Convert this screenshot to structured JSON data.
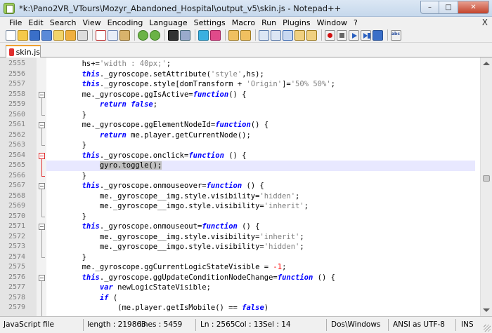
{
  "window": {
    "title": "*k:\\Pano2VR_VTours\\Mozyr_Abandoned_Hospital\\output_v5\\skin.js - Notepad++",
    "minimize": "–",
    "maximize": "□",
    "close": "✕"
  },
  "menu": {
    "items": [
      "File",
      "Edit",
      "Search",
      "View",
      "Encoding",
      "Language",
      "Settings",
      "Macro",
      "Run",
      "Plugins",
      "Window",
      "?"
    ],
    "close_glyph": "X"
  },
  "toolbar": {
    "icons": [
      "new-file-icon",
      "open-file-icon",
      "save-icon",
      "save-all-icon",
      "close-file-icon",
      "close-all-icon",
      "print-icon",
      "cut-icon",
      "copy-icon",
      "paste-icon",
      "undo-icon",
      "redo-icon",
      "find-icon",
      "replace-icon",
      "zoom-in-icon",
      "zoom-out-icon",
      "sync-vertical-icon",
      "sync-horizontal-icon",
      "word-wrap-icon",
      "show-all-chars-icon",
      "indent-guide-icon",
      "user-defined-language-icon",
      "document-map-icon",
      "record-macro-icon",
      "stop-recording-icon",
      "playback-macro-icon",
      "run-macro-multiple-icon",
      "save-macro-icon",
      "spell-check-icon"
    ]
  },
  "tabs": [
    {
      "label": "skin.js",
      "active": true,
      "modified": true
    }
  ],
  "editor": {
    "current_line": 2565,
    "lines": [
      {
        "n": "2555",
        "segs": [
          {
            "t": "        hs+=",
            "c": ""
          },
          {
            "t": "'width : 40px;'",
            "c": "str"
          },
          {
            "t": ";",
            "c": ""
          }
        ]
      },
      {
        "n": "2556",
        "segs": [
          {
            "t": "        ",
            "c": ""
          },
          {
            "t": "this",
            "c": "kw"
          },
          {
            "t": "._gyroscope.setAttribute(",
            "c": ""
          },
          {
            "t": "'style'",
            "c": "str"
          },
          {
            "t": ",hs);",
            "c": ""
          }
        ]
      },
      {
        "n": "2557",
        "segs": [
          {
            "t": "        ",
            "c": ""
          },
          {
            "t": "this",
            "c": "kw"
          },
          {
            "t": "._gyroscope.style[domTransform + ",
            "c": ""
          },
          {
            "t": "'Origin'",
            "c": "str"
          },
          {
            "t": "]=",
            "c": ""
          },
          {
            "t": "'50% 50%'",
            "c": "str"
          },
          {
            "t": ";",
            "c": ""
          }
        ]
      },
      {
        "n": "2558",
        "segs": [
          {
            "t": "        me._gyroscope.ggIsActive=",
            "c": ""
          },
          {
            "t": "function",
            "c": "kw"
          },
          {
            "t": "() {",
            "c": ""
          }
        ]
      },
      {
        "n": "2559",
        "segs": [
          {
            "t": "            ",
            "c": ""
          },
          {
            "t": "return",
            "c": "kw"
          },
          {
            "t": " ",
            "c": ""
          },
          {
            "t": "false",
            "c": "kw"
          },
          {
            "t": ";",
            "c": ""
          }
        ]
      },
      {
        "n": "2560",
        "segs": [
          {
            "t": "        }",
            "c": ""
          }
        ]
      },
      {
        "n": "2561",
        "segs": [
          {
            "t": "        me._gyroscope.ggElementNodeId=",
            "c": ""
          },
          {
            "t": "function",
            "c": "kw"
          },
          {
            "t": "() {",
            "c": ""
          }
        ]
      },
      {
        "n": "2562",
        "segs": [
          {
            "t": "            ",
            "c": ""
          },
          {
            "t": "return",
            "c": "kw"
          },
          {
            "t": " me.player.getCurrentNode();",
            "c": ""
          }
        ]
      },
      {
        "n": "2563",
        "segs": [
          {
            "t": "        }",
            "c": ""
          }
        ]
      },
      {
        "n": "2564",
        "segs": [
          {
            "t": "        ",
            "c": ""
          },
          {
            "t": "this",
            "c": "kw"
          },
          {
            "t": "._gyroscope.onclick=",
            "c": ""
          },
          {
            "t": "function",
            "c": "kw"
          },
          {
            "t": " () {",
            "c": ""
          }
        ]
      },
      {
        "n": "2565",
        "segs": [
          {
            "t": "            ",
            "c": ""
          },
          {
            "t": "gyro.toggle();",
            "c": "sel"
          }
        ]
      },
      {
        "n": "2566",
        "segs": [
          {
            "t": "        }",
            "c": ""
          }
        ]
      },
      {
        "n": "2567",
        "segs": [
          {
            "t": "        ",
            "c": ""
          },
          {
            "t": "this",
            "c": "kw"
          },
          {
            "t": "._gyroscope.onmouseover=",
            "c": ""
          },
          {
            "t": "function",
            "c": "kw"
          },
          {
            "t": " () {",
            "c": ""
          }
        ]
      },
      {
        "n": "2568",
        "segs": [
          {
            "t": "            me._gyroscope__img.style.visibility=",
            "c": ""
          },
          {
            "t": "'hidden'",
            "c": "str"
          },
          {
            "t": ";",
            "c": ""
          }
        ]
      },
      {
        "n": "2569",
        "segs": [
          {
            "t": "            me._gyroscope__imgo.style.visibility=",
            "c": ""
          },
          {
            "t": "'inherit'",
            "c": "str"
          },
          {
            "t": ";",
            "c": ""
          }
        ]
      },
      {
        "n": "2570",
        "segs": [
          {
            "t": "        }",
            "c": ""
          }
        ]
      },
      {
        "n": "2571",
        "segs": [
          {
            "t": "        ",
            "c": ""
          },
          {
            "t": "this",
            "c": "kw"
          },
          {
            "t": "._gyroscope.onmouseout=",
            "c": ""
          },
          {
            "t": "function",
            "c": "kw"
          },
          {
            "t": " () {",
            "c": ""
          }
        ]
      },
      {
        "n": "2572",
        "segs": [
          {
            "t": "            me._gyroscope__img.style.visibility=",
            "c": ""
          },
          {
            "t": "'inherit'",
            "c": "str"
          },
          {
            "t": ";",
            "c": ""
          }
        ]
      },
      {
        "n": "2573",
        "segs": [
          {
            "t": "            me._gyroscope__imgo.style.visibility=",
            "c": ""
          },
          {
            "t": "'hidden'",
            "c": "str"
          },
          {
            "t": ";",
            "c": ""
          }
        ]
      },
      {
        "n": "2574",
        "segs": [
          {
            "t": "        }",
            "c": ""
          }
        ]
      },
      {
        "n": "2575",
        "segs": [
          {
            "t": "        me._gyroscope.ggCurrentLogicStateVisible = ",
            "c": ""
          },
          {
            "t": "-1",
            "c": "num"
          },
          {
            "t": ";",
            "c": ""
          }
        ]
      },
      {
        "n": "2576",
        "segs": [
          {
            "t": "        ",
            "c": ""
          },
          {
            "t": "this",
            "c": "kw"
          },
          {
            "t": "._gyroscope.ggUpdateConditionNodeChange=",
            "c": ""
          },
          {
            "t": "function",
            "c": "kw"
          },
          {
            "t": " () {",
            "c": ""
          }
        ]
      },
      {
        "n": "2577",
        "segs": [
          {
            "t": "            ",
            "c": ""
          },
          {
            "t": "var",
            "c": "kw"
          },
          {
            "t": " newLogicStateVisible;",
            "c": ""
          }
        ]
      },
      {
        "n": "2578",
        "segs": [
          {
            "t": "            ",
            "c": ""
          },
          {
            "t": "if",
            "c": "kw"
          },
          {
            "t": " (",
            "c": ""
          }
        ]
      },
      {
        "n": "2579",
        "segs": [
          {
            "t": "                (me.player.getIsMobile() == ",
            "c": ""
          },
          {
            "t": "false",
            "c": "kw"
          },
          {
            "t": ")",
            "c": ""
          }
        ]
      }
    ]
  },
  "status": {
    "file_type": "JavaScript file",
    "length": "length : 219863",
    "lines": "lines : 5459",
    "ln": "Ln : 2565",
    "col": "Col : 13",
    "sel": "Sel : 14",
    "eol": "Dos\\Windows",
    "encoding": "ANSI as UTF-8",
    "mode": "INS"
  }
}
